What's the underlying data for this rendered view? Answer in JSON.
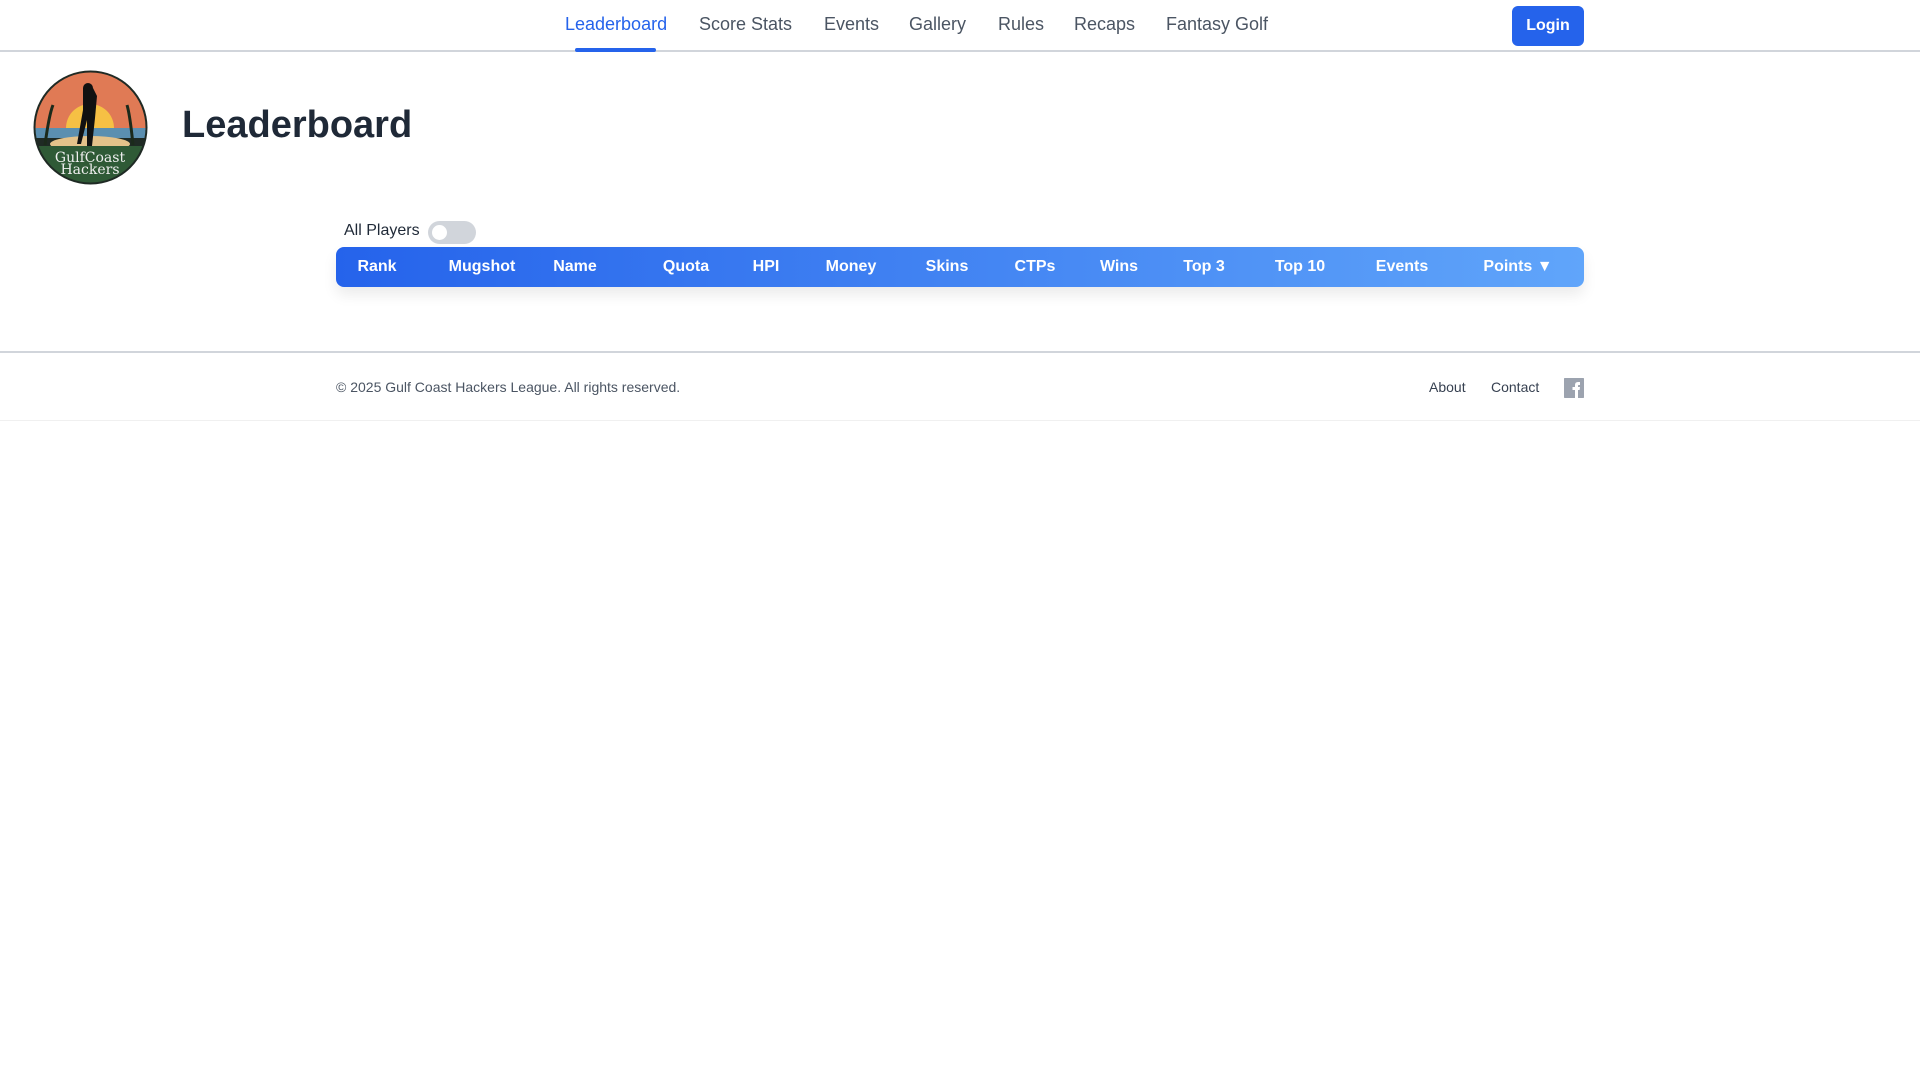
{
  "nav": {
    "items": [
      "Leaderboard",
      "Score Stats",
      "Events",
      "Gallery",
      "Rules",
      "Recaps",
      "Fantasy Golf"
    ],
    "active": "Leaderboard",
    "login": "Login"
  },
  "logo": {
    "text": "Gulf Coast Hackers League"
  },
  "page": {
    "title": "Leaderboard",
    "toggle_label": "All Players",
    "toggle_on": false
  },
  "table": {
    "columns": [
      "Rank",
      "Mugshot",
      "Name",
      "Quota",
      "HPI",
      "Money",
      "Skins",
      "CTPs",
      "Wins",
      "Top 3",
      "Top 10",
      "Events",
      "Points ▼"
    ]
  },
  "footer": {
    "copyright": "© 2025 Gulf Coast Hackers League. All rights reserved.",
    "about": "About",
    "contact": "Contact",
    "facebook_icon": "facebook-icon"
  },
  "colors": {
    "accent": "#2563eb",
    "gradient_end": "#60a5fa"
  }
}
